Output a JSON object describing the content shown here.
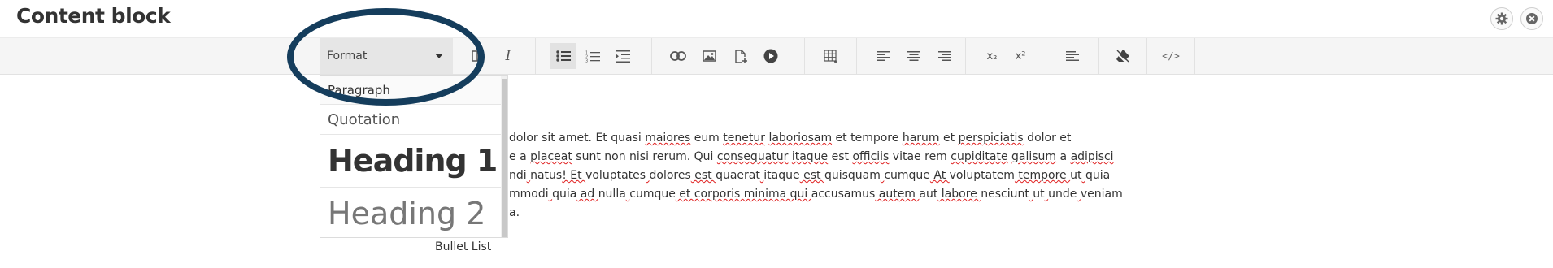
{
  "header": {
    "title": "Content block",
    "settings_icon": "gear-icon",
    "close_icon": "close-icon"
  },
  "toolbar": {
    "format_select": {
      "selected": "Format"
    },
    "buttons": [
      {
        "name": "bold-button",
        "icon": "bold-icon"
      },
      {
        "name": "italic-button",
        "icon": "italic-icon",
        "glyph": "I"
      },
      {
        "name": "bullet-list-button",
        "icon": "bullet-list-icon",
        "active": true
      },
      {
        "name": "numbered-list-button",
        "icon": "numbered-list-icon"
      },
      {
        "name": "indent-button",
        "icon": "indent-icon"
      },
      {
        "name": "link-button",
        "icon": "link-icon"
      },
      {
        "name": "image-button",
        "icon": "image-icon"
      },
      {
        "name": "file-button",
        "icon": "file-add-icon"
      },
      {
        "name": "media-button",
        "icon": "play-icon"
      },
      {
        "name": "table-button",
        "icon": "table-icon"
      },
      {
        "name": "align-left-button",
        "icon": "align-left-icon"
      },
      {
        "name": "align-center-button",
        "icon": "align-center-icon"
      },
      {
        "name": "align-right-button",
        "icon": "align-right-icon"
      },
      {
        "name": "subscript-button",
        "icon": "subscript-icon",
        "glyph": "x₂"
      },
      {
        "name": "superscript-button",
        "icon": "superscript-icon",
        "glyph": "x²"
      },
      {
        "name": "paragraph-style-button",
        "icon": "text-lines-icon"
      },
      {
        "name": "clear-format-button",
        "icon": "eraser-icon"
      },
      {
        "name": "source-code-button",
        "icon": "code-icon",
        "glyph": "</>"
      }
    ]
  },
  "format_dropdown": {
    "items": [
      {
        "label": "Paragraph"
      },
      {
        "label": "Quotation"
      },
      {
        "label": "Heading 1"
      },
      {
        "label": "Heading 2"
      }
    ]
  },
  "editor": {
    "lines": [
      [
        "dolor sit amet. Et quasi ",
        "maiores",
        " eum ",
        "tenetur",
        " ",
        "laboriosam",
        " et tempore ",
        "harum",
        " et ",
        "perspiciatis",
        " dolor et"
      ],
      [
        "e a ",
        "placeat",
        " sunt non nisi rerum. Qui ",
        "consequatur",
        " ",
        "itaque",
        " est ",
        "officiis",
        " vitae rem ",
        "cupiditate",
        " ",
        "galisum",
        " a ",
        "adipisci"
      ],
      [
        "ndi",
        " ",
        "natus",
        "! Et ",
        "voluptates",
        " ",
        "dolores",
        " est ",
        "quaerat",
        " ",
        "itaque",
        " est ",
        "quisquam",
        " ",
        "cumque",
        " At ",
        "voluptatem",
        " tempore ",
        "ut",
        " ",
        "quia"
      ],
      [
        "mmodi",
        " ",
        "quia",
        " ad ",
        "nulla",
        " ",
        "cumque",
        " et corporis minima qui ",
        "accusamus",
        " autem ",
        "aut",
        " labore ",
        "nesciunt",
        " ",
        "ut",
        " ",
        "unde",
        " ",
        "veniam"
      ],
      [
        "a."
      ]
    ],
    "tooltip": "Bullet List"
  },
  "colors": {
    "highlight_ellipse": "#153d5c",
    "toolbar_bg": "#f5f5f5",
    "spellcheck": "#e02020"
  }
}
